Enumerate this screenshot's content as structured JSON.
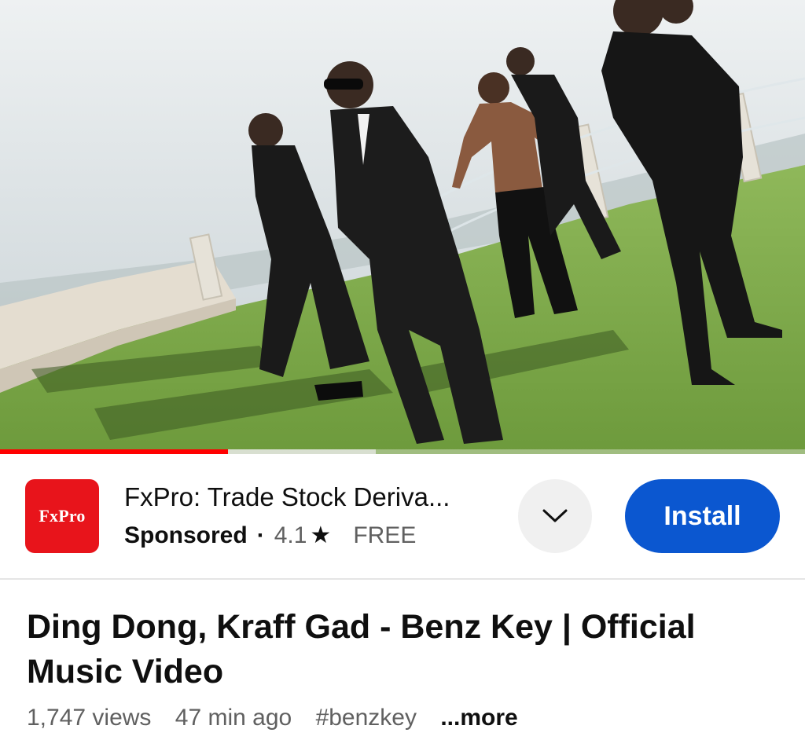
{
  "video": {
    "progress_played": 0.283,
    "progress_buffered": 0.467,
    "colors": {
      "played": "#ff0000"
    }
  },
  "ad": {
    "logo_text": "FxPro",
    "title": "FxPro: Trade Stock Deriva...",
    "sponsored_label": "Sponsored",
    "separator": "·",
    "rating": "4.1",
    "star_icon": "star-icon",
    "price": "FREE",
    "expand_icon": "chevron-down-icon",
    "install_label": "Install",
    "colors": {
      "brand": "#e8141b",
      "install": "#0b57d0"
    }
  },
  "details": {
    "title": "Ding Dong, Kraff Gad - Benz Key | Official Music Video",
    "views": "1,747 views",
    "age": "47 min ago",
    "hashtag": "#benzkey",
    "more_label": "...more"
  }
}
